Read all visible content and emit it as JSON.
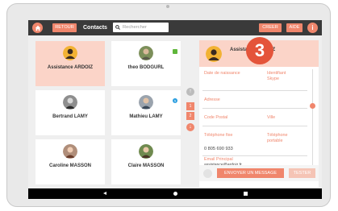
{
  "topbar": {
    "back_label": "RETOUR",
    "title": "Contacts",
    "search_placeholder": "Rechercher",
    "create_label": "CREER",
    "help_label": "AIDE",
    "info_icon": "i"
  },
  "step_badge": "3",
  "contacts": [
    {
      "name": "Assistance ARDOIZ",
      "selected": true
    },
    {
      "name": "theo BODGURL",
      "selected": false
    },
    {
      "name": "Bertrand LAMY",
      "selected": false
    },
    {
      "name": "Mathieu LAMY",
      "selected": false
    },
    {
      "name": "Caroline MASSON",
      "selected": false
    },
    {
      "name": "Claire MASSON",
      "selected": false
    }
  ],
  "nav": {
    "up_icon": "arrow-up-icon",
    "pages": [
      "1",
      "2"
    ],
    "down_icon": "arrow-down-icon"
  },
  "detail": {
    "name": "Assistance ARDOIZ",
    "fields": {
      "birthdate_label": "Date de naissance",
      "skype_label": "Identifiant Skype",
      "address_label": "Adresse",
      "postal_label": "Code Postal",
      "city_label": "Ville",
      "landline_label": "Téléphone fixe",
      "mobile_label": "Téléphone portable",
      "landline_value": "0 805 690 933",
      "email_label": "Email Principal",
      "email_value": "assistance@ardoiz.fr"
    },
    "send_label": "ENVOYER UN MESSAGE",
    "test_label": "TESTER"
  },
  "colors": {
    "accent": "#f0866c",
    "badge": "#e4543a",
    "selected_bg": "#fbd4c8",
    "topbar_bg": "#3a3a3a"
  }
}
